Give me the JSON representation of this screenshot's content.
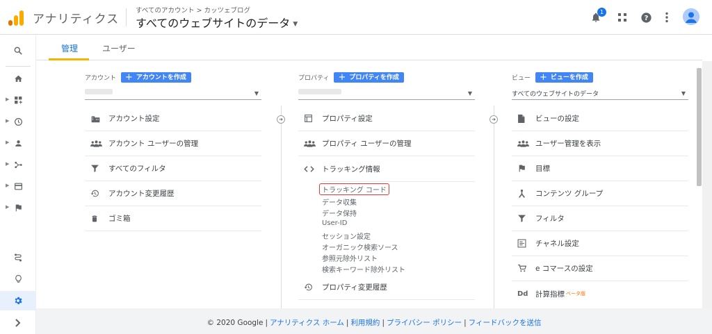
{
  "header": {
    "app_name": "アナリティクス",
    "breadcrumb": "すべてのアカウント > カッツェブログ",
    "view_title": "すべてのウェブサイトのデータ",
    "notification_count": "1"
  },
  "colors": {
    "accent": "#1a73e8",
    "button": "#4285f4",
    "logo_orange": "#f9ab00",
    "logo_dark": "#e37400",
    "highlight": "#e53935",
    "beta": "#ff6d00"
  },
  "tabs": [
    {
      "label": "管理"
    },
    {
      "label": "ユーザー"
    }
  ],
  "account": {
    "label": "アカウント",
    "create_button": "アカウントを作成",
    "items": [
      {
        "label": "アカウント設定",
        "icon": "building-icon"
      },
      {
        "label": "アカウント ユーザーの管理",
        "icon": "people-icon"
      },
      {
        "label": "すべてのフィルタ",
        "icon": "filter-icon"
      },
      {
        "label": "アカウント変更履歴",
        "icon": "history-icon"
      },
      {
        "label": "ゴミ箱",
        "icon": "trash-icon"
      }
    ]
  },
  "property": {
    "label": "プロパティ",
    "create_button": "プロパティを作成",
    "items": [
      {
        "label": "プロパティ設定",
        "icon": "property-settings-icon"
      },
      {
        "label": "プロパティ ユーザーの管理",
        "icon": "people-icon"
      },
      {
        "label": "トラッキング情報",
        "icon": "code-icon"
      }
    ],
    "tracking_subitems": [
      "トラッキング コード",
      "データ収集",
      "データ保持",
      "User-ID",
      "セッション設定",
      "オーガニック検索ソース",
      "参照元除外リスト",
      "検索キーワード除外リスト"
    ],
    "history_label": "プロパティ変更履歴"
  },
  "view": {
    "label": "ビュー",
    "create_button": "ビューを作成",
    "selected": "すべてのウェブサイトのデータ",
    "items": [
      {
        "label": "ビューの設定",
        "icon": "document-icon"
      },
      {
        "label": "ユーザー管理を表示",
        "icon": "people-icon"
      },
      {
        "label": "目標",
        "icon": "flag-icon"
      },
      {
        "label": "コンテンツ グループ",
        "icon": "content-group-icon"
      },
      {
        "label": "フィルタ",
        "icon": "filter-icon"
      },
      {
        "label": "チャネル設定",
        "icon": "channel-icon"
      },
      {
        "label": "e コマースの設定",
        "icon": "cart-icon"
      },
      {
        "label": "計算指標",
        "icon": "dd-icon"
      }
    ],
    "beta_label": "ベータ版"
  },
  "footer": {
    "copyright": "© 2020 Google",
    "links": [
      "アナリティクス ホーム",
      "利用規約",
      "プライバシー ポリシー",
      "フィードバックを送信"
    ]
  }
}
